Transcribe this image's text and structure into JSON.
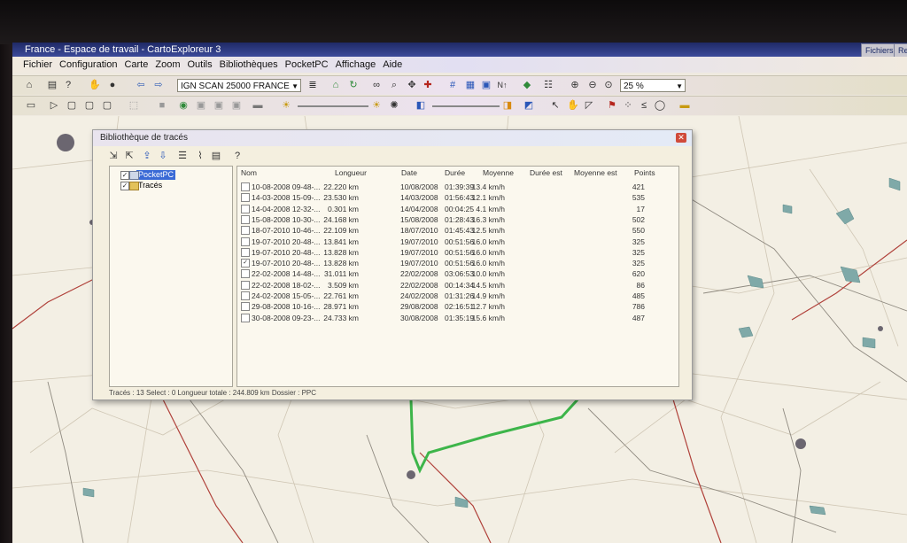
{
  "window": {
    "title": "France - Espace de travail - CartoExploreur 3",
    "right_tabs": [
      "Fichiers",
      "Re"
    ]
  },
  "menu": [
    "Fichier",
    "Configuration",
    "Carte",
    "Zoom",
    "Outils",
    "Bibliothèques",
    "PocketPC",
    "Affichage",
    "Aide"
  ],
  "toolbar": {
    "map_select": "IGN SCAN 25000 FRANCE",
    "zoom_select": "25 %"
  },
  "dialog": {
    "title": "Bibliothèque de tracés",
    "tree": [
      {
        "label": "PocketPC",
        "checked": true,
        "selected": true
      },
      {
        "label": "Tracés",
        "checked": true,
        "selected": false
      }
    ],
    "columns": [
      "Nom",
      "Longueur",
      "Date",
      "Durée",
      "Moyenne",
      "Durée est",
      "Moyenne est",
      "Points"
    ],
    "rows": [
      {
        "nom": "10-08-2008 09-48-...",
        "longueur": "22.220 km",
        "date": "10/08/2008",
        "duree": "01:39:39",
        "moyenne": "13.4 km/h",
        "points": "421",
        "checked": false
      },
      {
        "nom": "14-03-2008 15-09-...",
        "longueur": "23.530 km",
        "date": "14/03/2008",
        "duree": "01:56:43",
        "moyenne": "12.1 km/h",
        "points": "535",
        "checked": false
      },
      {
        "nom": "14-04-2008 12-32-...",
        "longueur": "0.301 km",
        "date": "14/04/2008",
        "duree": "00:04:25",
        "moyenne": "4.1 km/h",
        "points": "17",
        "checked": false
      },
      {
        "nom": "15-08-2008 10-30-...",
        "longueur": "24.168 km",
        "date": "15/08/2008",
        "duree": "01:28:43",
        "moyenne": "16.3 km/h",
        "points": "502",
        "checked": false
      },
      {
        "nom": "18-07-2010 10-46-...",
        "longueur": "22.109 km",
        "date": "18/07/2010",
        "duree": "01:45:43",
        "moyenne": "12.5 km/h",
        "points": "550",
        "checked": false
      },
      {
        "nom": "19-07-2010 20-48-...",
        "longueur": "13.841 km",
        "date": "19/07/2010",
        "duree": "00:51:56",
        "moyenne": "16.0 km/h",
        "points": "325",
        "checked": false
      },
      {
        "nom": "19-07-2010 20-48-...",
        "longueur": "13.828 km",
        "date": "19/07/2010",
        "duree": "00:51:56",
        "moyenne": "16.0 km/h",
        "points": "325",
        "checked": false
      },
      {
        "nom": "19-07-2010 20-48-...",
        "longueur": "13.828 km",
        "date": "19/07/2010",
        "duree": "00:51:56",
        "moyenne": "16.0 km/h",
        "points": "325",
        "checked": true
      },
      {
        "nom": "22-02-2008 14-48-...",
        "longueur": "31.011 km",
        "date": "22/02/2008",
        "duree": "03:06:53",
        "moyenne": "10.0 km/h",
        "points": "620",
        "checked": false
      },
      {
        "nom": "22-02-2008 18-02-...",
        "longueur": "3.509 km",
        "date": "22/02/2008",
        "duree": "00:14:34",
        "moyenne": "14.5 km/h",
        "points": "86",
        "checked": false
      },
      {
        "nom": "24-02-2008 15-05-...",
        "longueur": "22.761 km",
        "date": "24/02/2008",
        "duree": "01:31:26",
        "moyenne": "14.9 km/h",
        "points": "485",
        "checked": false
      },
      {
        "nom": "29-08-2008 10-16-...",
        "longueur": "28.971 km",
        "date": "29/08/2008",
        "duree": "02:16:51",
        "moyenne": "12.7 km/h",
        "points": "786",
        "checked": false
      },
      {
        "nom": "30-08-2008 09-23-...",
        "longueur": "24.733 km",
        "date": "30/08/2008",
        "duree": "01:35:19",
        "moyenne": "15.6 km/h",
        "points": "487",
        "checked": false
      }
    ],
    "status": "Tracés : 13 Select : 0 Longueur totale : 244.809 km Dossier : PPC"
  },
  "colors": {
    "titlebar": "#2a3580",
    "track": "#3db54a",
    "map_bg": "#f3efe4",
    "road": "#b0413a"
  }
}
